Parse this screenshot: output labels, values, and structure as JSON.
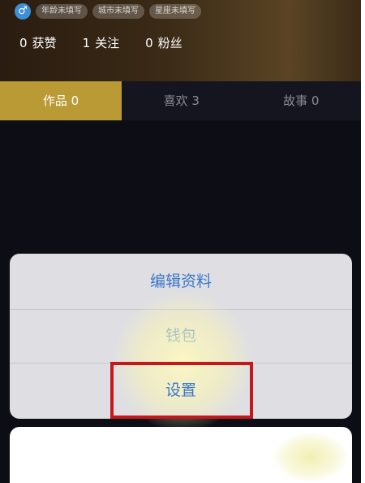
{
  "profile": {
    "gender_icon": "♂",
    "tags": [
      "年龄未填写",
      "城市未填写",
      "星座未填写"
    ],
    "stats": [
      {
        "num": "0",
        "label": "获赞"
      },
      {
        "num": "1",
        "label": "关注"
      },
      {
        "num": "0",
        "label": "粉丝"
      }
    ]
  },
  "tabs": [
    {
      "label": "作品 0"
    },
    {
      "label": "喜欢 3"
    },
    {
      "label": "故事 0"
    }
  ],
  "action_sheet": {
    "items": [
      {
        "label": "编辑资料"
      },
      {
        "label": "钱包"
      },
      {
        "label": "设置"
      }
    ]
  },
  "colors": {
    "tab_active": "#b99a35",
    "sheet_text": "#3a78c8",
    "highlight": "#c8161d"
  }
}
